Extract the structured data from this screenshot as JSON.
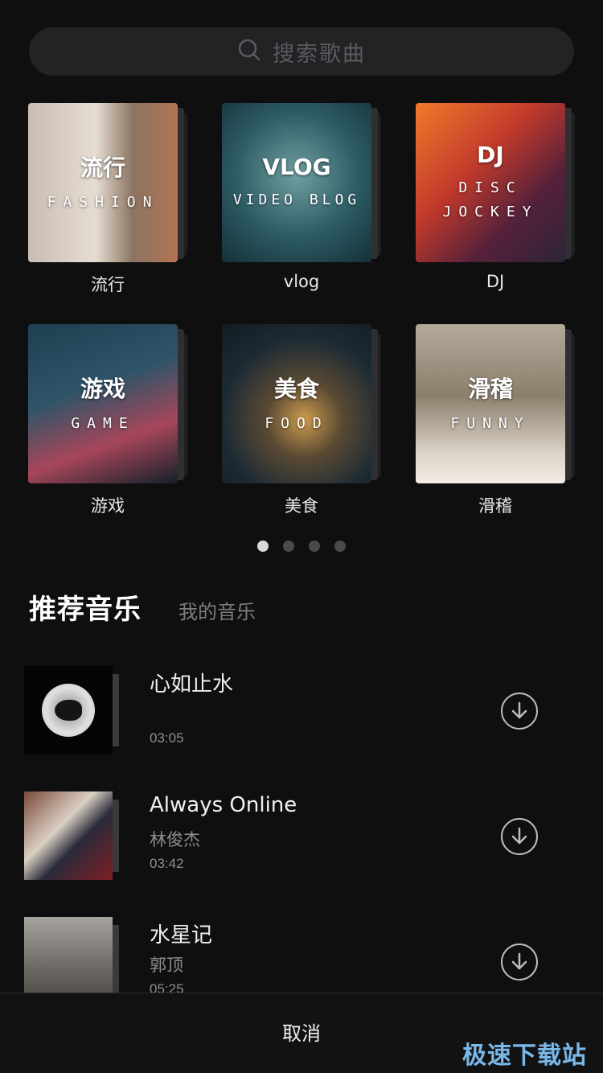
{
  "search": {
    "placeholder": "搜索歌曲"
  },
  "categories": [
    {
      "cover_title": "流行",
      "cover_subtitle": "FASHION",
      "label": "流行"
    },
    {
      "cover_title": "VLOG",
      "cover_subtitle": "VIDEO BLOG",
      "label": "vlog"
    },
    {
      "cover_title": "DJ",
      "cover_subtitle": "DISC JOCKEY",
      "label": "DJ"
    },
    {
      "cover_title": "游戏",
      "cover_subtitle": "GAME",
      "label": "游戏"
    },
    {
      "cover_title": "美食",
      "cover_subtitle": "FOOD",
      "label": "美食"
    },
    {
      "cover_title": "滑稽",
      "cover_subtitle": "FUNNY",
      "label": "滑稽"
    }
  ],
  "pager": {
    "count": 4,
    "active": 1
  },
  "tabs": {
    "recommended": "推荐音乐",
    "mine": "我的音乐"
  },
  "songs": [
    {
      "title": "心如止水",
      "artist": "",
      "duration": "03:05"
    },
    {
      "title": "Always Online",
      "artist": "林俊杰",
      "duration": "03:42"
    },
    {
      "title": "水星记",
      "artist": "郭顶",
      "duration": "05:25"
    }
  ],
  "footer": {
    "cancel_label": "取消",
    "watermark": "极速下载站"
  },
  "colors": {
    "background": "#0f0f10",
    "search_bg": "#232325",
    "accent_watermark": "#7ab8e8"
  }
}
